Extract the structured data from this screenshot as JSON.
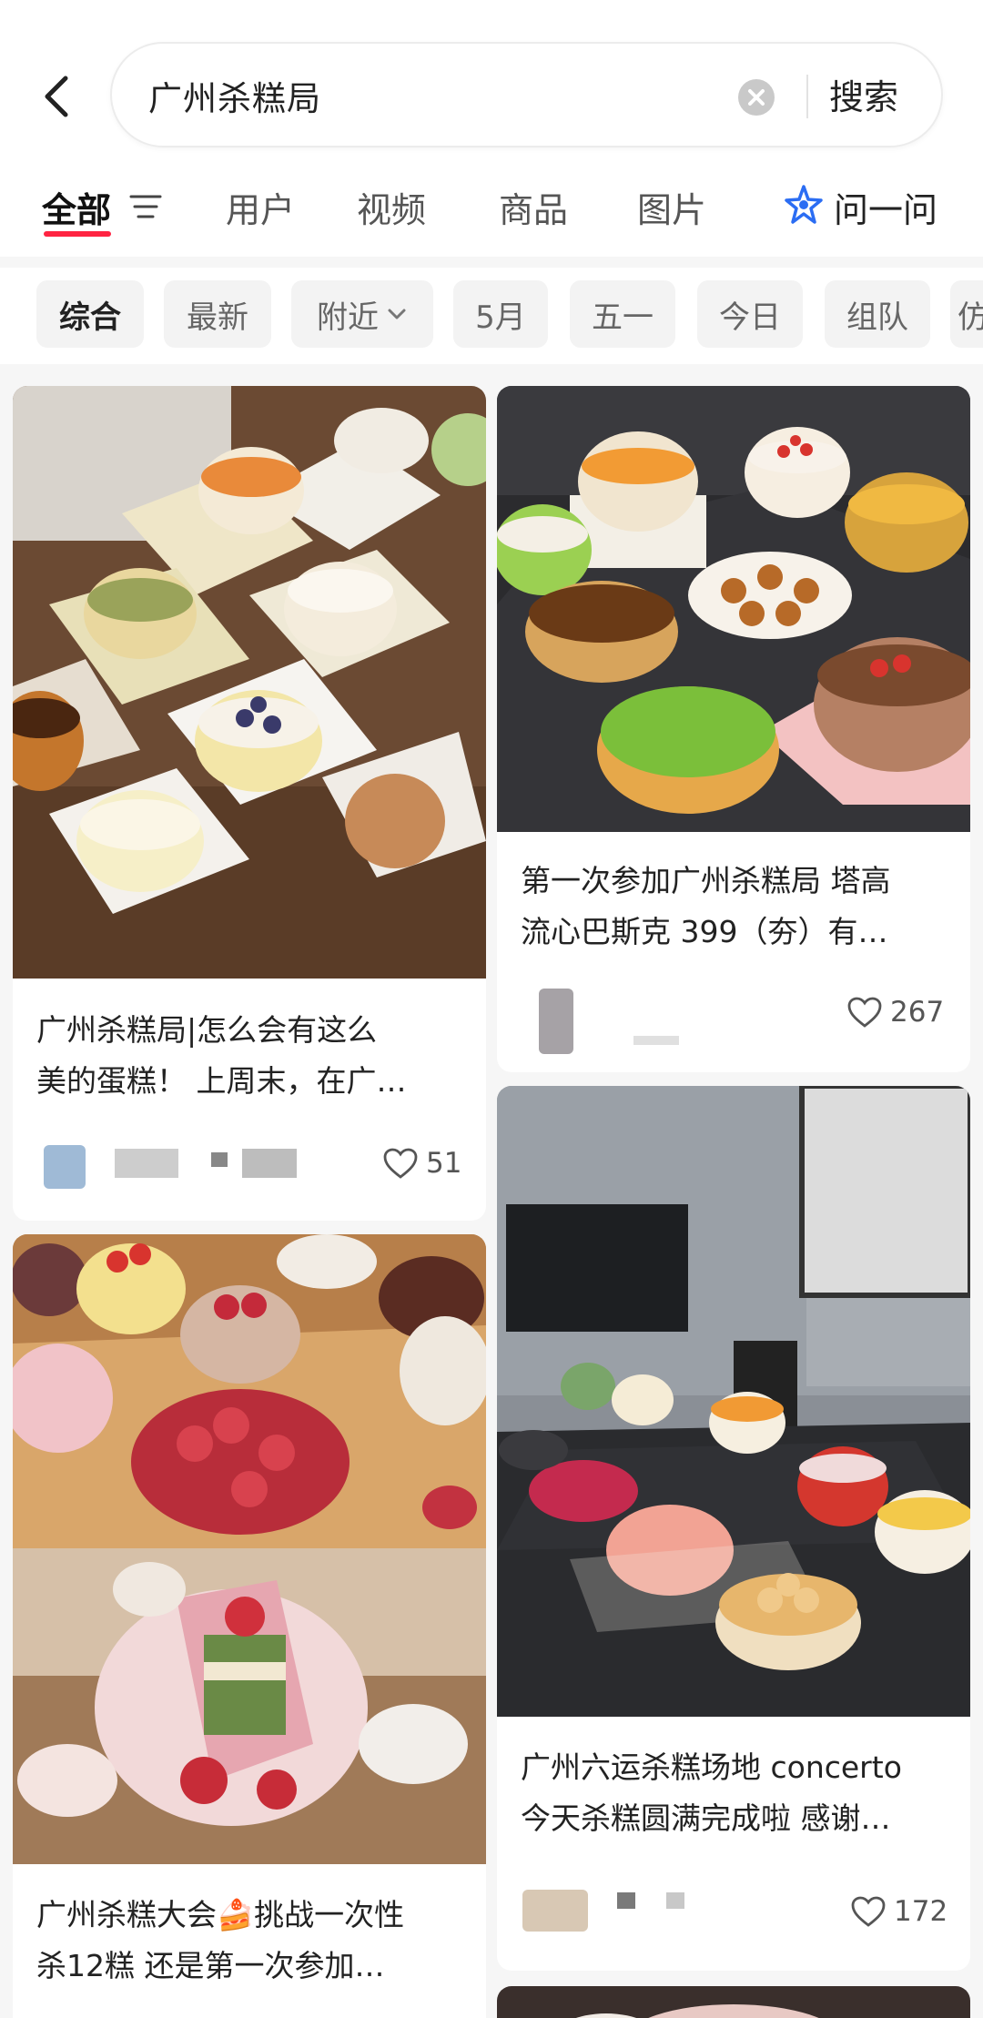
{
  "search": {
    "query": "广州杀糕局",
    "submit_label": "搜索"
  },
  "tabs": [
    {
      "label": "全部",
      "active": true
    },
    {
      "label": "用户"
    },
    {
      "label": "视频"
    },
    {
      "label": "商品"
    },
    {
      "label": "图片"
    },
    {
      "label": "问一问"
    }
  ],
  "chips": [
    {
      "label": "综合",
      "active": true
    },
    {
      "label": "最新"
    },
    {
      "label": "附近"
    },
    {
      "label": "5月"
    },
    {
      "label": "五一"
    },
    {
      "label": "今日"
    },
    {
      "label": "组队"
    },
    {
      "label": "仿"
    }
  ],
  "colors": {
    "accent": "#ff2442",
    "ask_icon": "#2b6df3"
  },
  "posts": [
    {
      "title_line1": "广州杀糕局|怎么会有这么",
      "title_line2": "美的蛋糕！ 上周末，在广…",
      "likes": "51"
    },
    {
      "title_line1": "第一次参加广州杀糕局 塔高",
      "title_line2": "流心巴斯克 399（夯）有…",
      "likes": "267"
    },
    {
      "title_line1": "广州六运杀糕场地 concerto",
      "title_line2": "今天杀糕圆满完成啦 感谢…",
      "likes": "172"
    },
    {
      "title_line1": "广州杀糕大会🍰挑战一次性",
      "title_line2": "杀12糕 还是第一次参加…"
    }
  ]
}
